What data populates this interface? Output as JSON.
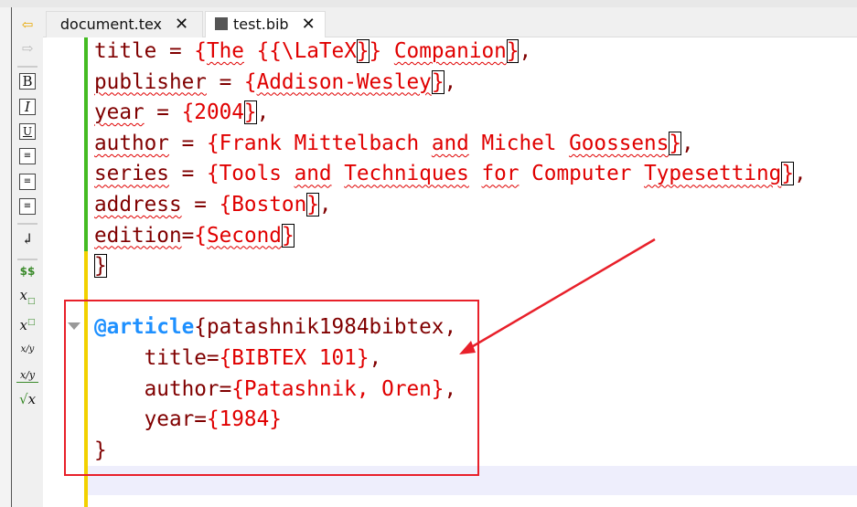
{
  "tabs": [
    {
      "label": "document.tex",
      "close": "✕"
    },
    {
      "label": "test.bib",
      "close": "✕"
    }
  ],
  "sidebar": {
    "bold": "B",
    "italic": "I",
    "underline": "U",
    "math": "$$",
    "subscript": "x□",
    "superscript": "x□",
    "fraction": "x/y",
    "dfrac": "x/y",
    "sqrt": "√x"
  },
  "code_lines": [
    [
      {
        "t": "title",
        "c": "key"
      },
      {
        "t": " = ",
        "c": "key"
      },
      {
        "t": "{",
        "c": "val"
      },
      {
        "t": "The",
        "c": "val spell"
      },
      {
        "t": " {{\\LaTeX",
        "c": "val"
      },
      {
        "t": "}",
        "c": "val match"
      },
      {
        "t": "} ",
        "c": "val"
      },
      {
        "t": "Companion",
        "c": "val spell"
      },
      {
        "t": "}",
        "c": "val match"
      },
      {
        "t": ",",
        "c": "key"
      }
    ],
    [
      {
        "t": "publisher",
        "c": "key spell"
      },
      {
        "t": " = ",
        "c": "key"
      },
      {
        "t": "{",
        "c": "val"
      },
      {
        "t": "Addison-Wesley",
        "c": "val spell"
      },
      {
        "t": "}",
        "c": "val match"
      },
      {
        "t": ",",
        "c": "key"
      }
    ],
    [
      {
        "t": "year",
        "c": "key spell"
      },
      {
        "t": " = ",
        "c": "key"
      },
      {
        "t": "{2004",
        "c": "val"
      },
      {
        "t": "}",
        "c": "val match"
      },
      {
        "t": ",",
        "c": "key"
      }
    ],
    [
      {
        "t": "author",
        "c": "key spell"
      },
      {
        "t": " = ",
        "c": "key"
      },
      {
        "t": "{Frank Mittelbach ",
        "c": "val"
      },
      {
        "t": "and",
        "c": "val spell"
      },
      {
        "t": " Michel ",
        "c": "val"
      },
      {
        "t": "Goossens",
        "c": "val spell"
      },
      {
        "t": "}",
        "c": "val match"
      },
      {
        "t": ",",
        "c": "key"
      }
    ],
    [
      {
        "t": "series",
        "c": "key spell"
      },
      {
        "t": " = ",
        "c": "key"
      },
      {
        "t": "{Tools ",
        "c": "val"
      },
      {
        "t": "and",
        "c": "val spell"
      },
      {
        "t": " ",
        "c": "val"
      },
      {
        "t": "Techniques",
        "c": "val spell"
      },
      {
        "t": " ",
        "c": "val"
      },
      {
        "t": "for",
        "c": "val spell"
      },
      {
        "t": " Computer ",
        "c": "val"
      },
      {
        "t": "Typesetting",
        "c": "val spell"
      },
      {
        "t": "}",
        "c": "val match"
      },
      {
        "t": ",",
        "c": "key"
      }
    ],
    [
      {
        "t": "address",
        "c": "key spell"
      },
      {
        "t": " = ",
        "c": "key"
      },
      {
        "t": "{Boston",
        "c": "val"
      },
      {
        "t": "}",
        "c": "val match"
      },
      {
        "t": ",",
        "c": "key"
      }
    ],
    [
      {
        "t": "edition",
        "c": "key spell"
      },
      {
        "t": "=",
        "c": "key"
      },
      {
        "t": "{",
        "c": "val"
      },
      {
        "t": "Second",
        "c": "val spell"
      },
      {
        "t": "}",
        "c": "val match"
      }
    ],
    [
      {
        "t": "}",
        "c": "key match"
      }
    ],
    [
      {
        "t": "",
        "c": "key"
      }
    ],
    [
      {
        "t": "@article",
        "c": "kw"
      },
      {
        "t": "{patashnik1984bibtex,",
        "c": "key"
      }
    ],
    [
      {
        "t": "    title=",
        "c": "key"
      },
      {
        "t": "{BIBTEX 101}",
        "c": "val"
      },
      {
        "t": ",",
        "c": "key"
      }
    ],
    [
      {
        "t": "    author=",
        "c": "key"
      },
      {
        "t": "{Patashnik, Oren}",
        "c": "val"
      },
      {
        "t": ",",
        "c": "key"
      }
    ],
    [
      {
        "t": "    year=",
        "c": "key"
      },
      {
        "t": "{1984}",
        "c": "val"
      }
    ],
    [
      {
        "t": "}",
        "c": "key"
      }
    ]
  ],
  "annotation_color": "#e8202a"
}
